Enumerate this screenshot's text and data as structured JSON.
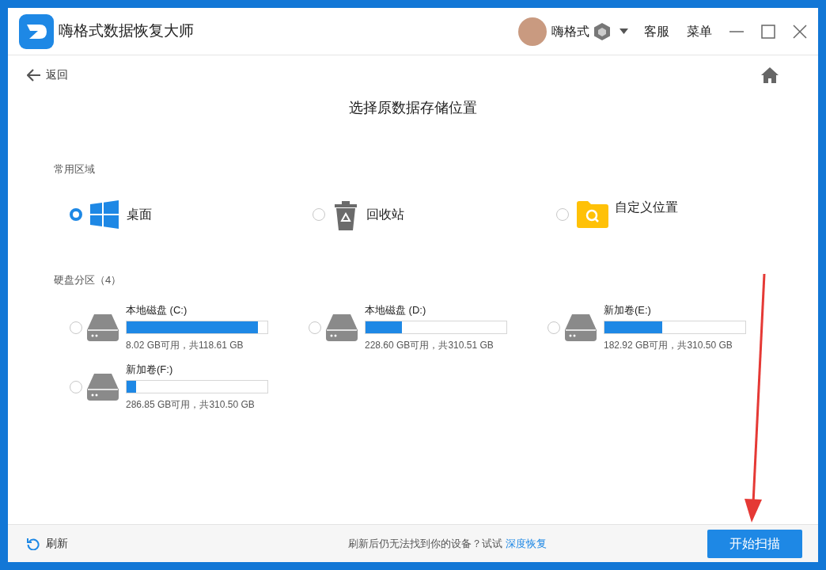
{
  "window": {
    "title": "嗨格式数据恢复大师"
  },
  "user": {
    "name": "嗨格式"
  },
  "header_links": [
    "客服",
    "菜单"
  ],
  "back": {
    "label": "返回"
  },
  "heading": "选择原数据存储位置",
  "common": {
    "title": "常用区域",
    "items": [
      {
        "kind": "desktop",
        "label": "桌面",
        "selected": true
      },
      {
        "kind": "recycle",
        "label": "回收站",
        "selected": false
      },
      {
        "kind": "custom",
        "label": "自定义位置",
        "selected": false
      }
    ]
  },
  "partitions": {
    "title": "硬盘分区（4）",
    "items": [
      {
        "name": "本地磁盘 (C:)",
        "level": 0.93,
        "info": "8.02 GB可用，共118.61 GB",
        "selected": false
      },
      {
        "name": "本地磁盘 (D:)",
        "level": 0.26,
        "info": "228.60 GB可用，共310.51 GB",
        "selected": false
      },
      {
        "name": "新加卷(E:)",
        "level": 0.41,
        "info": "182.92 GB可用，共310.50 GB",
        "selected": false
      },
      {
        "name": "新加卷(F:)",
        "level": 0.07,
        "info": "286.85 GB可用，共310.50 GB",
        "selected": false
      }
    ]
  },
  "footer": {
    "refresh": "刷新",
    "hint": "刷新后仍无法找到你的设备？试试",
    "link": "深度恢复",
    "scan_button": "开始扫描"
  }
}
